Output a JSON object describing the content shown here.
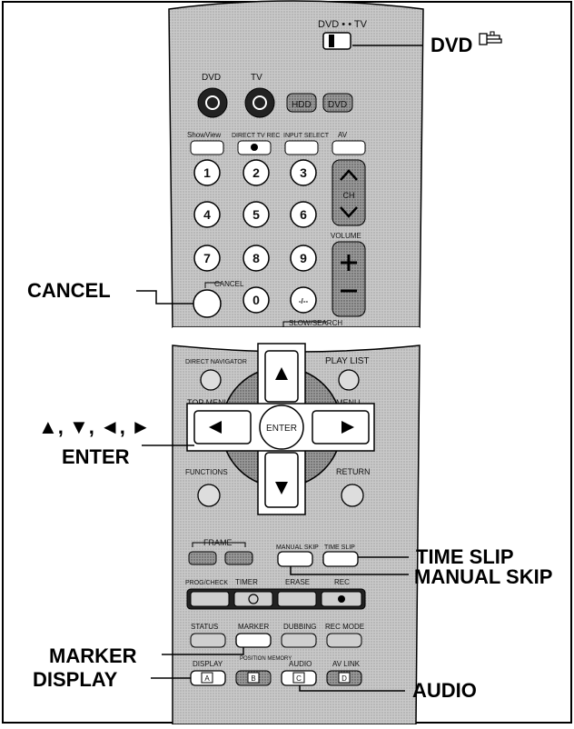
{
  "callouts": {
    "dvd": "DVD",
    "cancel": "CANCEL",
    "arrows": "▲, ▼, ◄, ►",
    "enter": "ENTER",
    "time_slip": "TIME SLIP",
    "manual_skip": "MANUAL SKIP",
    "marker": "MARKER",
    "display": "DISPLAY",
    "audio": "AUDIO"
  },
  "remote": {
    "switch_label": "DVD • • TV",
    "dvd_power": "DVD",
    "tv_power": "TV",
    "hdd": "HDD",
    "dvd": "DVD",
    "showview": "ShowView",
    "direct_tv_rec": "DIRECT TV REC",
    "input_select": "INPUT SELECT",
    "av": "AV",
    "digits": [
      "1",
      "2",
      "3",
      "4",
      "5",
      "6",
      "7",
      "8",
      "9",
      "0"
    ],
    "dash_slash": "-/--",
    "ch": "CH",
    "volume": "VOLUME",
    "cancel": "CANCEL",
    "slow_search": "SLOW/SEARCH",
    "direct_navigator": "DIRECT NAVIGATOR",
    "top_menu": "TOP MENU",
    "play_list": "PLAY LIST",
    "menu": "MENU",
    "enter": "ENTER",
    "functions": "FUNCTIONS",
    "return": "RETURN",
    "frame": "FRAME",
    "manual_skip": "MANUAL SKIP",
    "time_slip": "TIME SLIP",
    "prog_check": "PROG/CHECK",
    "timer": "TIMER",
    "erase": "ERASE",
    "rec": "REC",
    "status": "STATUS",
    "marker": "MARKER",
    "dubbing": "DUBBING",
    "rec_mode": "REC MODE",
    "display": "DISPLAY",
    "position_memory": "POSITION MEMORY",
    "audio": "AUDIO",
    "av_link": "AV LINK",
    "key_a": "A",
    "key_b": "B",
    "key_c": "C",
    "key_d": "D"
  }
}
